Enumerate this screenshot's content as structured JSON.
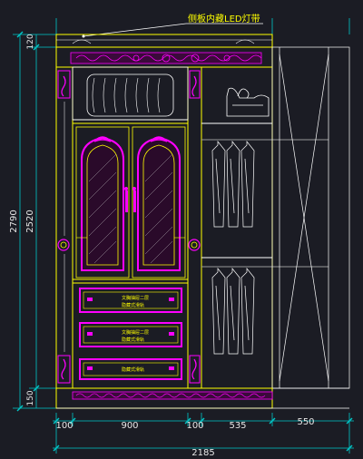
{
  "annotation": {
    "led_note": "侧板内藏LED灯带"
  },
  "dimensions": {
    "top_height": "120",
    "total_height": "2790",
    "body_height": "2520",
    "base_height": "150",
    "w_side_left": "100",
    "w_doors": "900",
    "w_side_mid": "100",
    "w_open": "535",
    "w_end": "550",
    "w_total": "2185"
  },
  "drawer_labels": [
    {
      "line1": "文胸抽屉二层",
      "line2": "隐藏式滑轨"
    },
    {
      "line1": "文胸抽屉二层",
      "line2": "隐藏式滑轨"
    },
    {
      "line1": "隐藏式滑轨"
    }
  ],
  "colors": {
    "background": "#1b1c24",
    "outline": "#ffff00",
    "ornament": "#ff00ff",
    "linework": "#ffffff",
    "dimension": "#00c8c8",
    "shelf": "#9a9a9a"
  }
}
